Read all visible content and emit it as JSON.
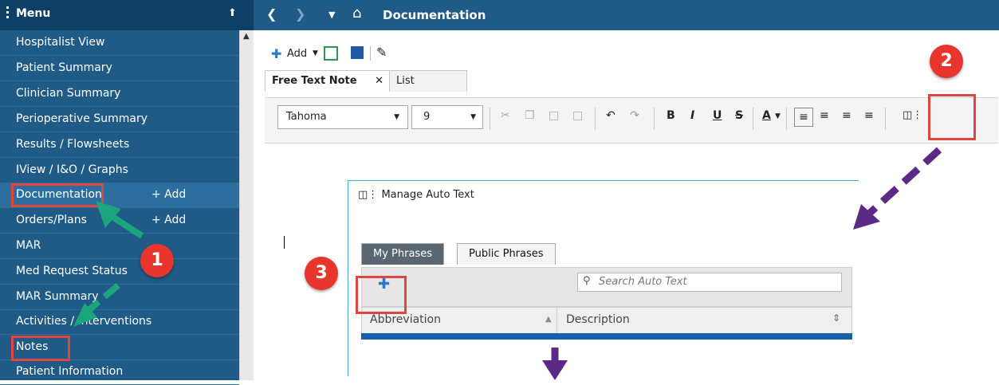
{
  "sidebar": {
    "title": "Menu",
    "items": [
      {
        "label": "Hospitalist View"
      },
      {
        "label": "Patient Summary"
      },
      {
        "label": "Clinician Summary"
      },
      {
        "label": "Perioperative Summary"
      },
      {
        "label": "Results / Flowsheets"
      },
      {
        "label": "IView / I&O / Graphs"
      },
      {
        "label": "Documentation",
        "add": "+ Add"
      },
      {
        "label": "Orders/Plans",
        "add": "+ Add"
      },
      {
        "label": "MAR"
      },
      {
        "label": "Med Request Status"
      },
      {
        "label": "MAR Summary"
      },
      {
        "label": "Activities / Interventions"
      },
      {
        "label": "Notes"
      },
      {
        "label": "Patient Information"
      }
    ]
  },
  "topbar": {
    "title": "Documentation"
  },
  "toolbar": {
    "add_label": "Add"
  },
  "tabs": [
    {
      "label": "Free Text Note"
    },
    {
      "label": "List"
    }
  ],
  "format": {
    "font": "Tahoma",
    "size": "9"
  },
  "panel": {
    "title": "Manage Auto Text",
    "tabs": [
      "My Phrases",
      "Public Phrases"
    ],
    "search_placeholder": "Search Auto Text",
    "columns": [
      "Abbreviation",
      "Description"
    ]
  },
  "callouts": [
    "1",
    "2",
    "3"
  ],
  "colors": {
    "sidebar": "#1f5b86",
    "header": "#0e3f66",
    "callout": "#e8362e",
    "green_arrow": "#1aa57c",
    "purple_arrow": "#5b2a86"
  }
}
